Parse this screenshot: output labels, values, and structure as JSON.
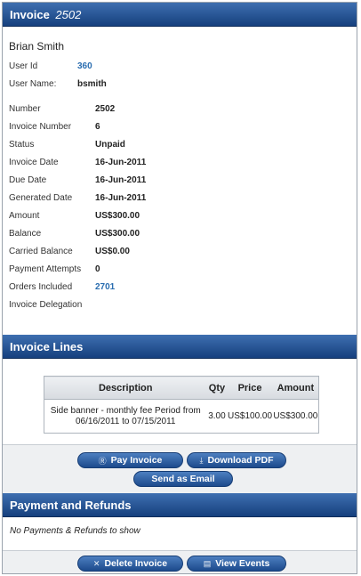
{
  "invoice_header": {
    "title": "Invoice",
    "number": "2502"
  },
  "customer": {
    "name": "Brian Smith",
    "user_id_label": "User Id",
    "user_id": "360",
    "user_name_label": "User Name:",
    "user_name": "bsmith"
  },
  "fields": [
    {
      "label": "Number",
      "value": "2502"
    },
    {
      "label": "Invoice Number",
      "value": "6"
    },
    {
      "label": "Status",
      "value": "Unpaid"
    },
    {
      "label": "Invoice Date",
      "value": "16-Jun-2011"
    },
    {
      "label": "Due Date",
      "value": "16-Jun-2011"
    },
    {
      "label": "Generated Date",
      "value": "16-Jun-2011"
    },
    {
      "label": "Amount",
      "value": "US$300.00"
    },
    {
      "label": "Balance",
      "value": "US$300.00"
    },
    {
      "label": "Carried Balance",
      "value": "US$0.00"
    },
    {
      "label": "Payment Attempts",
      "value": "0"
    },
    {
      "label": "Orders Included",
      "value": "2701"
    },
    {
      "label": "Invoice Delegation",
      "value": ""
    }
  ],
  "lines": {
    "title": "Invoice Lines",
    "columns": [
      "Description",
      "Qty",
      "Price",
      "Amount"
    ],
    "rows": [
      {
        "description": "Side banner - monthly fee Period from 06/16/2011 to 07/15/2011",
        "qty": "3.00",
        "price": "US$100.00",
        "amount": "US$300.00"
      }
    ]
  },
  "actions": {
    "pay_invoice": "Pay Invoice",
    "download_pdf": "Download PDF",
    "send_email": "Send as Email"
  },
  "payments": {
    "title": "Payment and Refunds",
    "empty_message": "No Payments & Refunds to show",
    "delete_invoice": "Delete Invoice",
    "view_events": "View Events"
  },
  "icons": {
    "pay": "circle-dollar-icon",
    "pdf": "download-icon",
    "delete": "x-icon",
    "events": "list-icon"
  },
  "colors": {
    "header": "#1f4a8a",
    "link": "#2a6db0"
  }
}
